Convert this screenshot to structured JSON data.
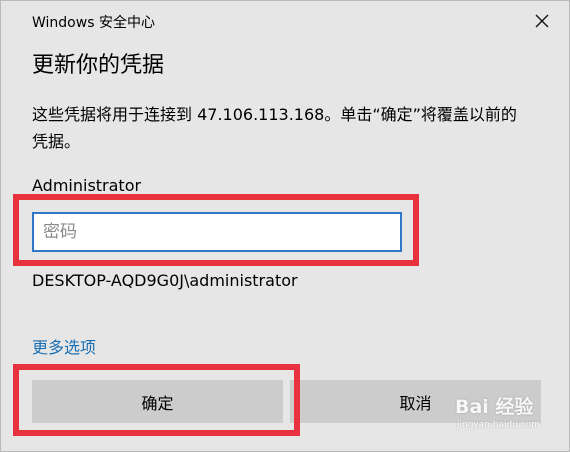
{
  "window": {
    "app_title": "Windows 安全中心",
    "close_icon": "close-icon"
  },
  "dialog": {
    "heading": "更新你的凭据",
    "message": "这些凭据将用于连接到 47.106.113.168。单击“确定”将覆盖以前的凭据。",
    "username": "Administrator",
    "password_value": "",
    "password_placeholder": "密码",
    "account": "DESKTOP-AQD9G0J\\administrator",
    "more_options_label": "更多选项",
    "ok_label": "确定",
    "cancel_label": "取消"
  },
  "annotations": {
    "highlight_color": "#e8333f"
  },
  "watermark": {
    "text": "Bai 经验",
    "sub": "jingyan.baidu.com"
  },
  "colors": {
    "dialog_bg": "#e6e6e6",
    "input_border": "#2b79c7",
    "link": "#1a6fb3",
    "button_bg": "#cccccc"
  }
}
